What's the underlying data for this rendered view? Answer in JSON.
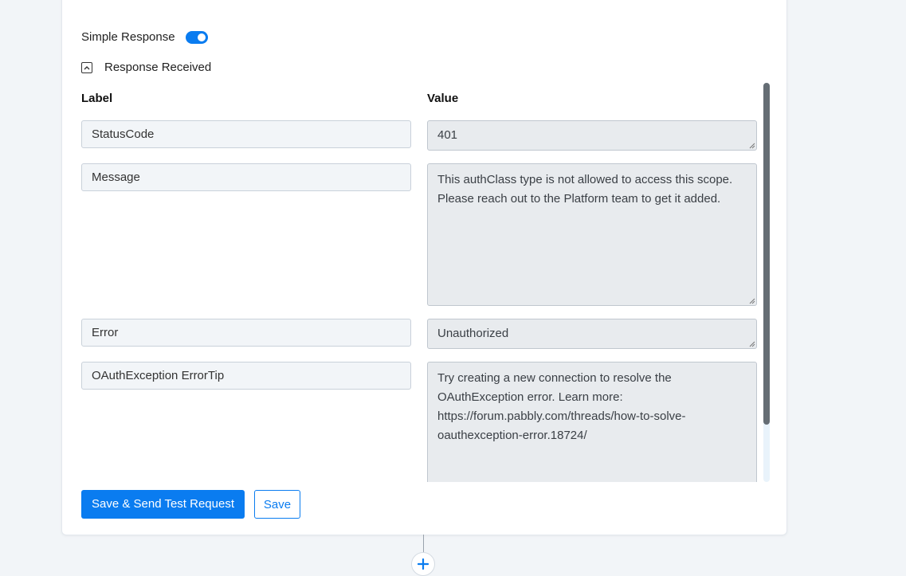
{
  "response": {
    "simple_response_label": "Simple Response",
    "simple_response_on": true,
    "response_received_label": "Response Received"
  },
  "columns": {
    "label": "Label",
    "value": "Value"
  },
  "rows": [
    {
      "label": "StatusCode",
      "value": "401"
    },
    {
      "label": "Message",
      "value": "This authClass type is not allowed to access this scope. Please reach out to the Platform team to get it added."
    },
    {
      "label": "Error",
      "value": "Unauthorized"
    },
    {
      "label": "OAuthException ErrorTip",
      "value": "Try creating a new connection to resolve the OAuthException error. Learn more: https://forum.pabbly.com/threads/how-to-solve-oauthexception-error.18724/"
    }
  ],
  "buttons": {
    "save_send": "Save & Send Test Request",
    "save": "Save"
  },
  "icons": {
    "collapse": "chevron-up-icon",
    "add_step": "plus-icon",
    "resize": "resize-grip-icon"
  },
  "colors": {
    "accent": "#0a7cf0",
    "value_bg": "#e8ebee",
    "label_bg": "#f2f5f8"
  }
}
